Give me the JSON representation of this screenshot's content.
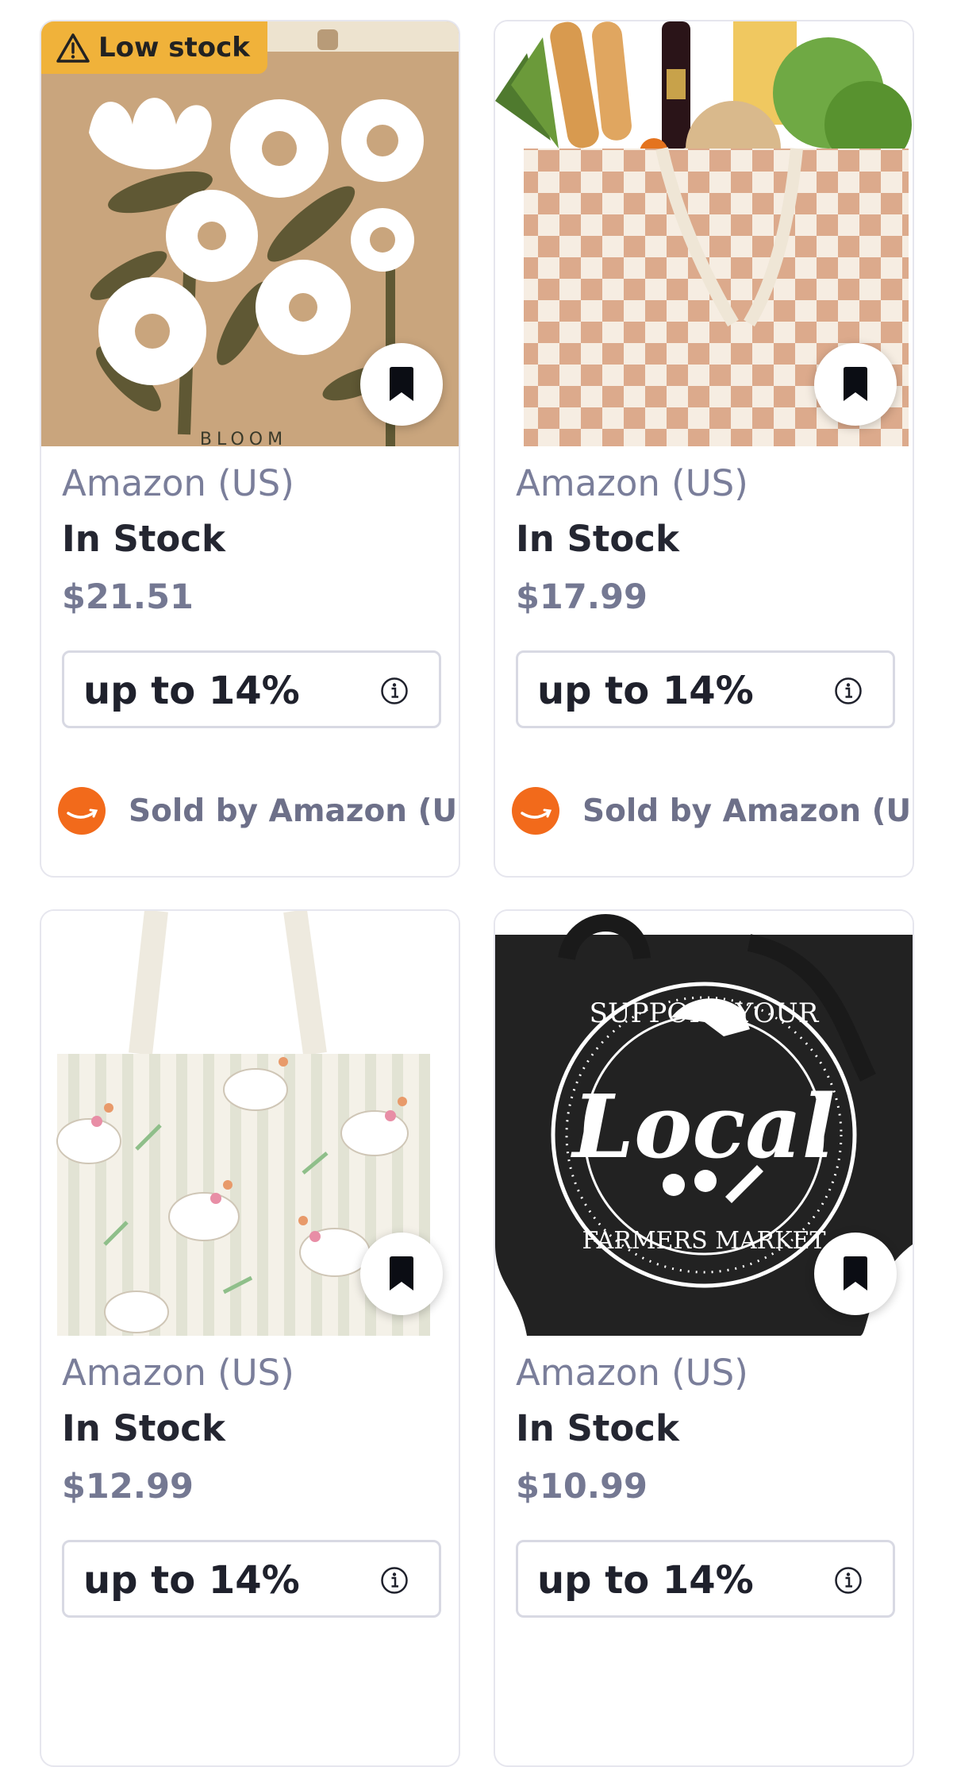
{
  "products": [
    {
      "badge": "Low stock",
      "badge_icon": "warning-icon",
      "image_desc": "tote-bloom",
      "store": "Amazon (US)",
      "stock": "In Stock",
      "price": "$21.51",
      "cashback": "up to 14%",
      "seller": "Sold by Amazon (U..."
    },
    {
      "image_desc": "tote-checkered",
      "store": "Amazon (US)",
      "stock": "In Stock",
      "price": "$17.99",
      "cashback": "up to 14%",
      "seller": "Sold by Amazon (U..."
    },
    {
      "image_desc": "tote-geese",
      "store": "Amazon (US)",
      "stock": "In Stock",
      "price": "$12.99",
      "cashback": "up to 14%"
    },
    {
      "image_desc": "tote-local",
      "store": "Amazon (US)",
      "stock": "In Stock",
      "price": "$10.99",
      "cashback": "up to 14%"
    }
  ],
  "bloom_text": "BLOOM",
  "local_ring_top": "SUPPORT YOUR",
  "local_script": "Local",
  "local_ring_bottom": "FARMERS MARKET",
  "colors": {
    "low_stock_badge": "#f0b23a",
    "store_text": "#7a7e9a",
    "stock_text": "#242631",
    "price_text": "#747892",
    "seller_logo": "#f26a1b"
  },
  "icons": {
    "save": "bookmark-icon",
    "info": "info-icon",
    "seller_logo": "amazon-logo-icon"
  }
}
